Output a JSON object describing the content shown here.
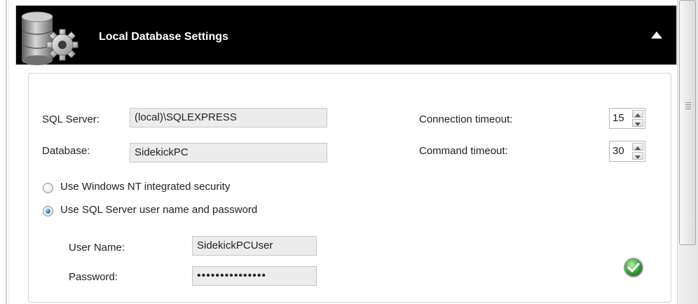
{
  "header": {
    "title": "Local Database Settings"
  },
  "connection": {
    "sql_server_label": "SQL Server:",
    "sql_server_value": "(local)\\SQLEXPRESS",
    "database_label": "Database:",
    "database_value": "SidekickPC",
    "connection_timeout_label": "Connection timeout:",
    "connection_timeout_value": "15",
    "command_timeout_label": "Command timeout:",
    "command_timeout_value": "30"
  },
  "auth": {
    "options": [
      {
        "label": "Use Windows NT integrated security",
        "checked": false
      },
      {
        "label": "Use SQL Server user name and password",
        "checked": true
      }
    ],
    "username_label": "User Name:",
    "username_value": "SidekickPCUser",
    "password_label": "Password:",
    "password_value": "•••••••••••••••"
  },
  "colors": {
    "header_bg": "#000000",
    "ok_green": "#3aa33a"
  },
  "icons": [
    "database-gear-icon",
    "collapse-arrow-icon",
    "spin-up-icon",
    "spin-down-icon",
    "ok-check-icon"
  ]
}
